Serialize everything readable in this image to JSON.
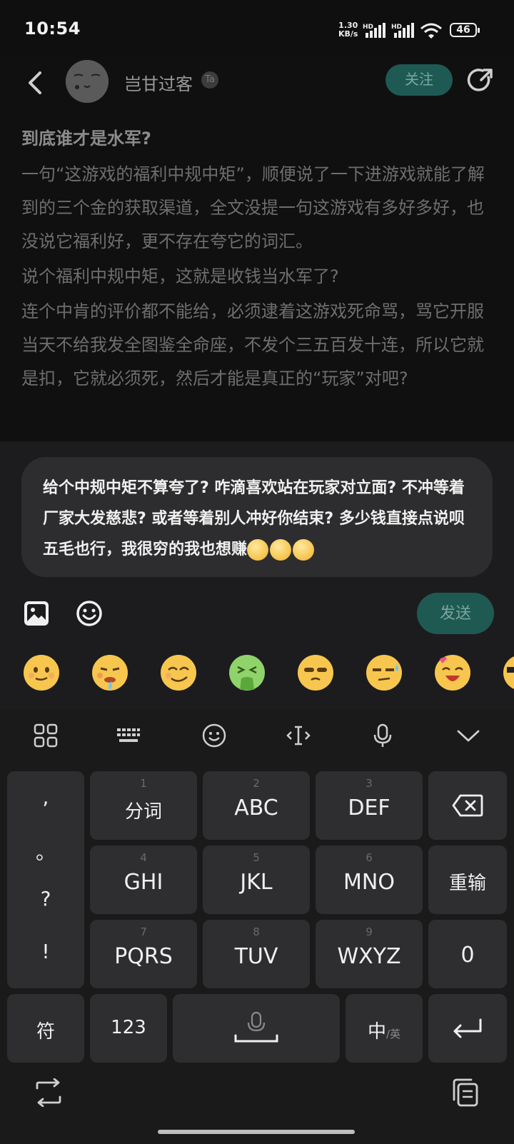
{
  "status_bar": {
    "time": "10:54",
    "net_speed_value": "1.30",
    "net_speed_unit": "KB/s",
    "hd1": "HD",
    "hd2": "HD",
    "battery": "46"
  },
  "header": {
    "username": "岂甘过客",
    "badge": "Ta",
    "follow_label": "关注"
  },
  "article": {
    "title": "到底谁才是水军?",
    "paragraphs": [
      "一句“这游戏的福利中规中矩”，顺便说了一下进游戏就能了解到的三个金的获取渠道，全文没提一句这游戏有多好多好，也没说它福利好，更不存在夸它的词汇。",
      "说个福利中规中矩，这就是收钱当水军了?",
      "连个中肯的评价都不能给，必须逮着这游戏死命骂，骂它开服当天不给我发全图鉴全命座，不发个三五百发十连，所以它就是扣，它就必须死，然后才能是真正的“玩家”对吧?"
    ]
  },
  "reply": {
    "text": "给个中规中矩不算夸了? 咋滴喜欢站在玩家对立面? 不冲等着厂家大发慈悲? 或者等着别人冲好你结束? 多少钱直接点说呗五毛也行，我很穷的我也想赚",
    "send_label": "发送"
  },
  "keyboard": {
    "keys": {
      "k1": {
        "num": "1",
        "label": "分词"
      },
      "k2": {
        "num": "2",
        "label": "ABC"
      },
      "k3": {
        "num": "3",
        "label": "DEF"
      },
      "k4": {
        "num": "4",
        "label": "GHI"
      },
      "k5": {
        "num": "5",
        "label": "JKL"
      },
      "k6": {
        "num": "6",
        "label": "MNO"
      },
      "k7": {
        "num": "7",
        "label": "PQRS"
      },
      "k8": {
        "num": "8",
        "label": "TUV"
      },
      "k9": {
        "num": "9",
        "label": "WXYZ"
      }
    },
    "reenter": "重输",
    "zero": "0",
    "symbols": "符",
    "num_mode": "123",
    "lang_main": "中",
    "lang_sub": "/英",
    "punct": [
      ",",
      "。",
      "?",
      "!"
    ]
  },
  "colors": {
    "accent": "#1f5a52",
    "background": "#101010",
    "panel": "#1c1c1e",
    "key": "#2e2e30"
  }
}
